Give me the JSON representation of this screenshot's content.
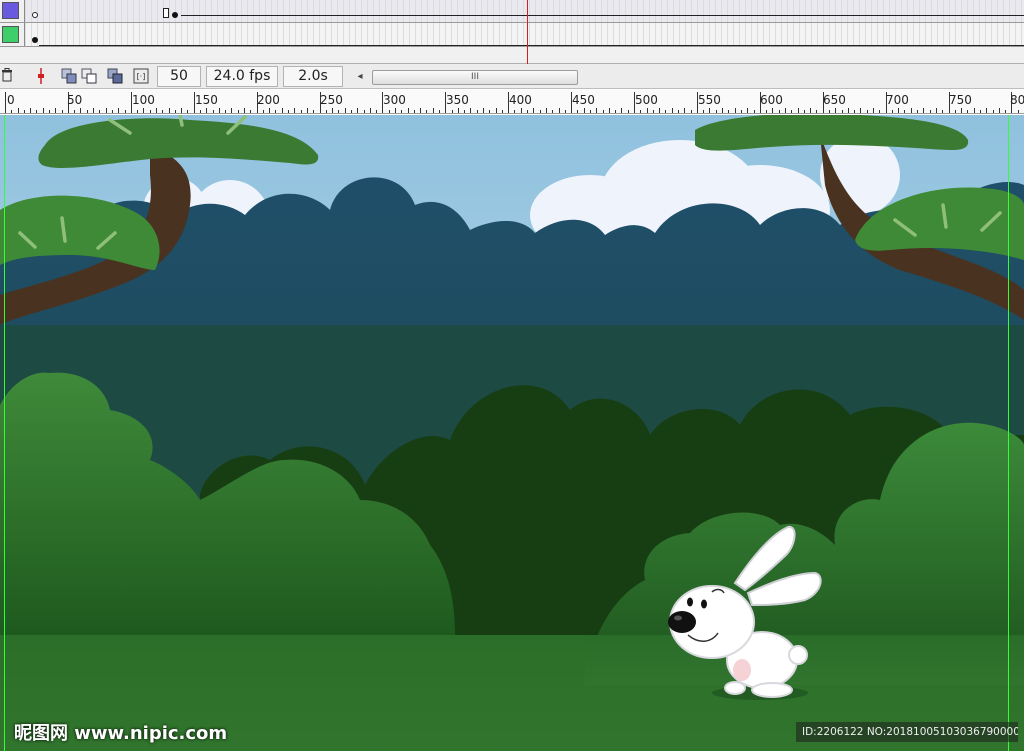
{
  "timeline": {
    "layers": [
      {
        "color": "#6a5ae0",
        "selected": true
      },
      {
        "color": "#3fcf6a",
        "selected": false
      }
    ],
    "playhead_color": "#d02020"
  },
  "controlbar": {
    "icons": [
      "trash-icon",
      "center-frame-icon",
      "onion-skin-icon",
      "onion-skin-outline-icon",
      "edit-multiple-frames-icon",
      "modify-onion-markers-icon"
    ],
    "current_frame": "50",
    "frame_rate": "24.0 fps",
    "elapsed_time": "2.0s",
    "scroll_left_arrow": "◂",
    "scroll_thumb_grip": "III"
  },
  "ruler": {
    "labels": [
      "0",
      "50",
      "100",
      "150",
      "200",
      "250",
      "300",
      "350",
      "400",
      "450",
      "500",
      "550",
      "600",
      "650",
      "700",
      "750",
      "80"
    ]
  },
  "stage": {
    "sky_color": "#9cc7df",
    "guide_color": "#33ff33"
  },
  "watermark": {
    "site": "昵图网 www.nipic.com",
    "id": "ID:2206122 NO:20181005103036790000"
  }
}
